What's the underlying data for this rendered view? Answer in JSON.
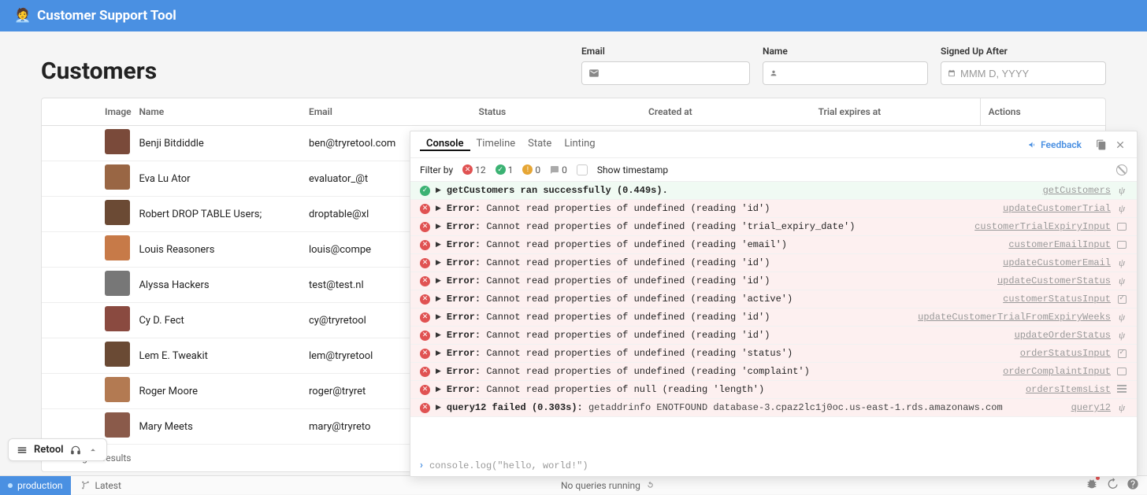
{
  "header": {
    "title": "Customer Support Tool",
    "emoji": "🧑‍💼"
  },
  "page": {
    "title": "Customers"
  },
  "filters": {
    "email": {
      "label": "Email",
      "value": "",
      "placeholder": ""
    },
    "name": {
      "label": "Name",
      "value": "",
      "placeholder": ""
    },
    "signed_after": {
      "label": "Signed Up After",
      "value": "",
      "placeholder": "MMM D, YYYY"
    }
  },
  "table": {
    "columns": [
      "Image",
      "Name",
      "Email",
      "Status",
      "Created at",
      "Trial expires at",
      "Actions"
    ],
    "rows": [
      {
        "name": "Benji Bitdiddle",
        "email": "ben@tryretool.com",
        "avatar": "#7a4a3a"
      },
      {
        "name": "Eva Lu Ator",
        "email": "evaluator_@t",
        "avatar": "#996644"
      },
      {
        "name": "Robert DROP TABLE Users;",
        "email": "droptable@xl",
        "avatar": "#6b4a34"
      },
      {
        "name": "Louis Reasoners",
        "email": "louis@compe",
        "avatar": "#c77a48"
      },
      {
        "name": "Alyssa Hackers",
        "email": "test@test.nl",
        "avatar": "#777"
      },
      {
        "name": "Cy D. Fect",
        "email": "cy@tryretool",
        "avatar": "#8a4a40"
      },
      {
        "name": "Lem E. Tweakit",
        "email": "lem@tryretool",
        "avatar": "#6a4a34"
      },
      {
        "name": "Roger Moore",
        "email": "roger@tryret",
        "avatar": "#b37a52"
      },
      {
        "name": "Mary Meets",
        "email": "mary@tryreto",
        "avatar": "#8a5a4a"
      }
    ],
    "footer": "Showing 14 results"
  },
  "retool_widget": {
    "label": "Retool"
  },
  "statusbar": {
    "env": "production",
    "latest": "Latest",
    "center": "No queries running"
  },
  "console": {
    "tabs": [
      "Console",
      "Timeline",
      "State",
      "Linting"
    ],
    "active_tab": 0,
    "feedback_label": "Feedback",
    "filter": {
      "label": "Filter by",
      "err_count": "12",
      "ok_count": "1",
      "warn_count": "0",
      "info_count": "0",
      "timestamp_label": "Show timestamp"
    },
    "logs": [
      {
        "type": "ok",
        "msg": "getCustomers ran successfully (0.449s).",
        "src": "getCustomers",
        "ico": "api"
      },
      {
        "type": "err",
        "prop": "'id'",
        "src": "updateCustomerTrial",
        "ico": "api"
      },
      {
        "type": "err",
        "prop": "'trial_expiry_date'",
        "src": "customerTrialExpiryInput",
        "ico": "box"
      },
      {
        "type": "err",
        "prop": "'email'",
        "src": "customerEmailInput",
        "ico": "box"
      },
      {
        "type": "err",
        "prop": "'id'",
        "src": "updateCustomerEmail",
        "ico": "api"
      },
      {
        "type": "err",
        "prop": "'id'",
        "src": "updateCustomerStatus",
        "ico": "api"
      },
      {
        "type": "err",
        "prop": "'active'",
        "src": "customerStatusInput",
        "ico": "check"
      },
      {
        "type": "err",
        "prop": "'id'",
        "src": "updateCustomerTrialFromExpiryWeeks",
        "ico": "api"
      },
      {
        "type": "err",
        "prop": "'id'",
        "src": "updateOrderStatus",
        "ico": "api"
      },
      {
        "type": "err",
        "prop": "'status'",
        "src": "orderStatusInput",
        "ico": "check"
      },
      {
        "type": "err",
        "prop": "'complaint'",
        "src": "orderComplaintInput",
        "ico": "box"
      },
      {
        "type": "err",
        "subject": "null",
        "prop": "'length'",
        "src": "ordersItemsList",
        "ico": "list"
      },
      {
        "type": "err",
        "raw": "query12 failed (0.303s):",
        "after": "getaddrinfo ENOTFOUND database-3.cpaz2lc1j0oc.us-east-1.rds.amazonaws.com",
        "src": "query12",
        "ico": "api"
      }
    ],
    "err_prefix": "Error:",
    "err_template_a": "Cannot read properties of ",
    "err_template_b": " (reading ",
    "err_template_c": ")",
    "default_subject": "undefined",
    "prompt": "console.log(\"hello, world!\")"
  }
}
